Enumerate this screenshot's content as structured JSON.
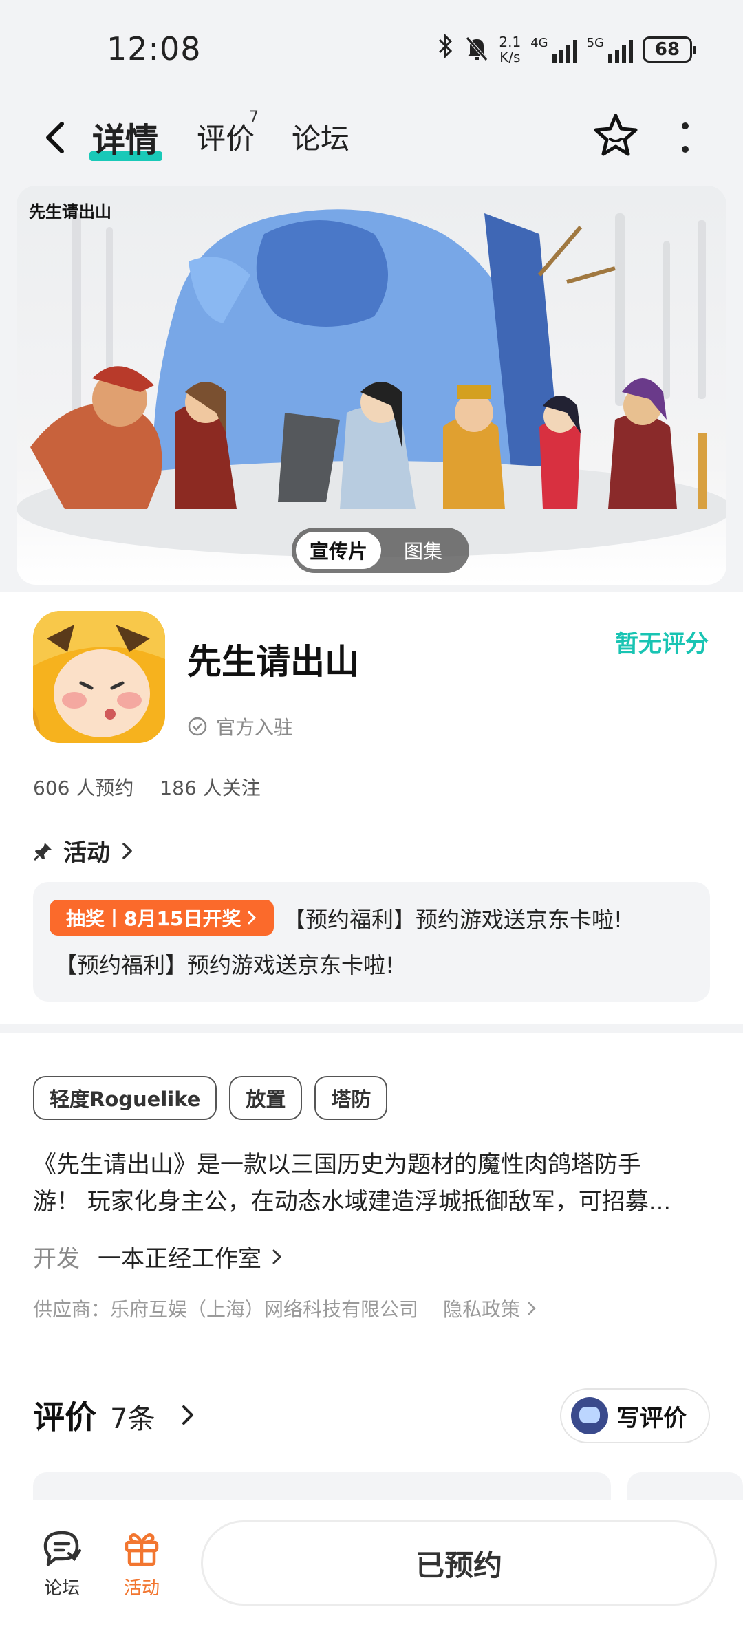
{
  "status_bar": {
    "time": "12:08",
    "net_speed_value": "2.1",
    "net_speed_unit": "K/s",
    "signal1_label": "4G",
    "signal2_label": "5G",
    "battery": "68"
  },
  "nav": {
    "tabs": [
      {
        "label": "详情"
      },
      {
        "label": "评价",
        "badge": "7"
      },
      {
        "label": "论坛"
      }
    ]
  },
  "banner": {
    "logo_text": "先生请出山",
    "media_tabs": [
      "宣传片",
      "图集"
    ]
  },
  "game": {
    "title": "先生请出山",
    "official_label": "官方入驻",
    "rating_text": "暂无评分",
    "reservations": "606 人预约",
    "follows": "186 人关注"
  },
  "activity": {
    "header": "活动",
    "badge": "抽奖丨8月15日开奖",
    "line1": "【预约福利】预约游戏送京东卡啦!",
    "line2": "【预约福利】预约游戏送京东卡啦!"
  },
  "tags": [
    "轻度Roguelike",
    "放置",
    "塔防"
  ],
  "description": {
    "line1": "《先生请出山》是一款以三国历史为题材的魔性肉鸽塔防手",
    "line2": "游！ 玩家化身主公，在动态水域建造浮城抵御敌军，可招募..."
  },
  "developer": {
    "label": "开发",
    "name": "一本正经工作室"
  },
  "supplier": {
    "text": "供应商：乐府互娱（上海）网络科技有限公司",
    "privacy": "隐私政策"
  },
  "reviews": {
    "title": "评价",
    "count": "7条",
    "write_button": "写评价"
  },
  "bottom_bar": {
    "forum_label": "论坛",
    "activity_label": "活动",
    "reserve_button": "已预约"
  },
  "colors": {
    "accent_teal": "#19c4b3",
    "accent_orange": "#fb6a2b",
    "active_tab_orange": "#f27630"
  }
}
